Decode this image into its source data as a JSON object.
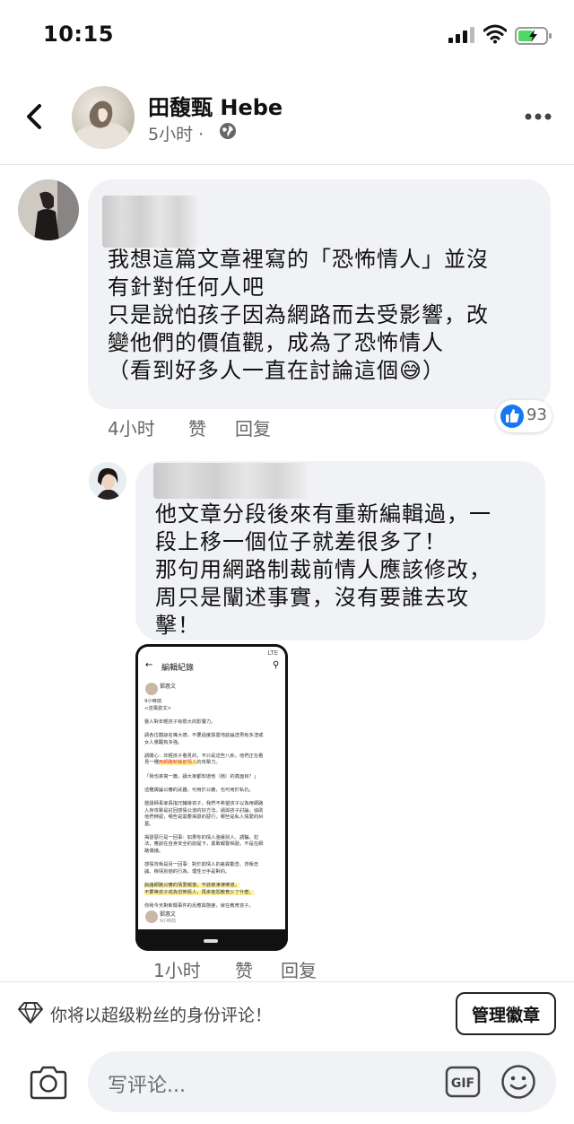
{
  "status_bar": {
    "time": "10:15"
  },
  "post": {
    "poster_name": "田馥甄 Hebe",
    "post_time": "5小时 ·"
  },
  "comments": [
    {
      "text": "我想這篇文章裡寫的「恐怖情人」並沒\n有針對任何人吧\n只是說怕孩子因為網路而去受影響，改\n變他們的價值觀，成為了恐怖情人\n（看到好多人一直在討論這個😅）",
      "time": "4小时",
      "like_label": "赞",
      "reply_label": "回复",
      "reaction_count": "93"
    },
    {
      "text": "他文章分段後來有重新編輯過，一\n段上移一個位子就差很多了！\n那句用網路制裁前情人應該修改，\n周只是闡述事實，沒有要誰去攻\n擊！",
      "time": "1小时",
      "like_label": "赞",
      "reply_label": "回复"
    }
  ],
  "screenshot": {
    "status": "LTE",
    "title": "編輯紀錄",
    "author": "鄧惠文",
    "lines_1": "9小時前\n<逆風發文>\n\n藝人對年輕孩子有很大的影響力。\n\n請各位體諒名嘴大德，不要過度與置地談論渣男有多渣或\n女人覺醒有多強。\n\n請關心：年輕孩子看見的，不只是這些八卦。他們正在看\n見一種",
    "highlight_1": "用網路制裁前情人",
    "lines_2": "的攻擊力。\n\n「我也來寫一篇，讓大家都知道他（她）的真面目？」\n\n這種輿論公審的武器，可用於公義，也可用於私仇。\n\n懇請師長家長指冗輔導孩子，我們不希望孩子以為用網路\n人身攻擊是討回感情公道的好方法。請與孩子討論，協助\n他們辨認，哪些是需要揭發的惡行，哪些是私人情愛的糾\n葛。\n\n揭發惡行是一回事：如果你的情人強暴別人、誘騙、犯\n法，應該在自身安全的前提下，勇敢報警揭發。不是在網\n路傳播。\n\n感情背叛是另一回事：對於前情人的差異觀念、背叛忠\n誠、移情別戀的行為，理性分手是對的。\n\n",
    "highlight_2": "訴諸網路公審的情愛報復，不該被津津樂道，\n不要等孩子成為恐怖情人，再來抱怨教育少了什麼。",
    "lines_3": "\n\n你我今天對新聞事件的反應與態度，就在教育孩子。",
    "author_2": "鄧惠文",
    "time_2": "9小時前"
  },
  "fan_bar": {
    "text": "你将以超级粉丝的身份评论！",
    "manage_button": "管理徽章"
  },
  "composer": {
    "placeholder": "写评论..."
  },
  "colors": {
    "bubble": "#f0f2f5",
    "like_blue": "#1877f2",
    "secondary_text": "#65676b"
  },
  "icons": [
    "back-icon",
    "globe-icon",
    "more-icon",
    "like-icon",
    "diamond-icon",
    "camera-icon",
    "gif-icon",
    "emoji-icon"
  ]
}
